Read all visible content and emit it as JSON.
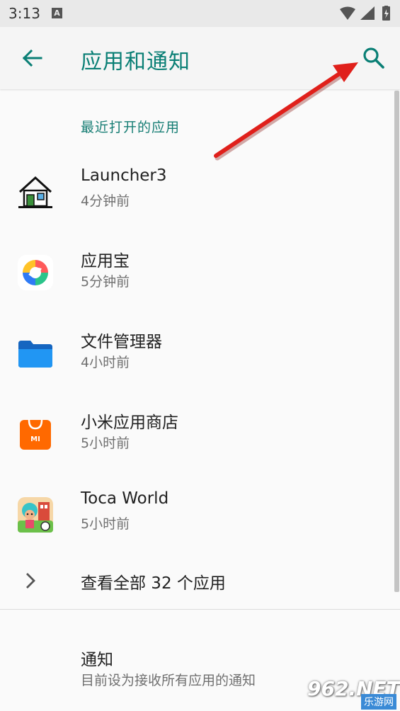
{
  "status_bar": {
    "time": "3:13",
    "notification_icon": "A"
  },
  "app_bar": {
    "title": "应用和通知",
    "back_icon": "arrow-back-icon",
    "search_icon": "search-icon"
  },
  "recent_section": {
    "header": "最近打开的应用",
    "apps": [
      {
        "name": "Launcher3",
        "time": "4分钟前",
        "icon": "launcher-house-icon"
      },
      {
        "name": "应用宝",
        "time": "5分钟前",
        "icon": "yingyongbao-icon"
      },
      {
        "name": "文件管理器",
        "time": "4小时前",
        "icon": "folder-icon"
      },
      {
        "name": "小米应用商店",
        "time": "5小时前",
        "icon": "mi-store-icon"
      },
      {
        "name": "Toca World",
        "time": "5小时前",
        "icon": "toca-world-icon"
      }
    ]
  },
  "see_all": {
    "label": "查看全部 32 个应用"
  },
  "notifications": {
    "title": "通知",
    "summary": "目前设为接收所有应用的通知"
  },
  "watermark": {
    "main": "962.NET",
    "sub": "乐游网"
  },
  "colors": {
    "accent": "#0a7f75",
    "arrow": "#e0201b"
  }
}
